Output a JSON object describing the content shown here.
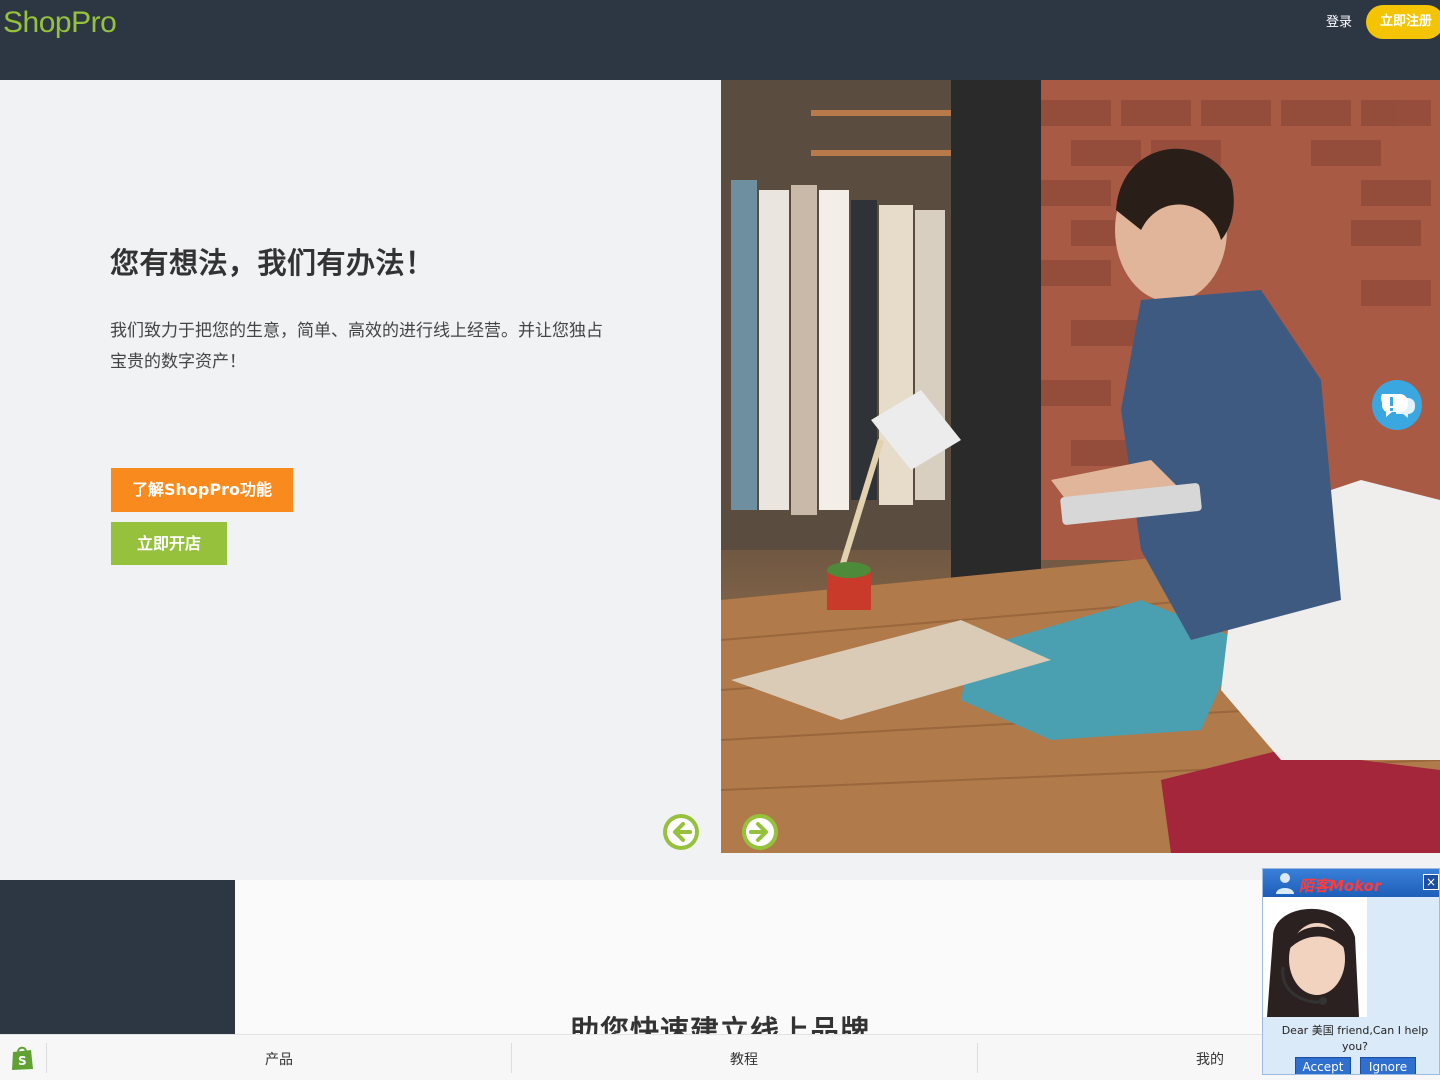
{
  "header": {
    "logo": "ShopPro",
    "login_label": "登录",
    "signup_label": "立即注册"
  },
  "hero": {
    "title": "您有想法，我们有办法！",
    "description": "我们致力于把您的生意，简单、高效的进行线上经营。并让您独占宝贵的数字资产！",
    "features_button": "了解ShopPro功能",
    "open_store_button": "立即开店"
  },
  "section": {
    "title": "助您快速建立线上品牌"
  },
  "bottom_nav": {
    "items": [
      {
        "label": "产品"
      },
      {
        "label": "教程"
      },
      {
        "label": "我的"
      }
    ]
  },
  "chat_widget": {
    "brand": "陌客Mokor",
    "message": "Dear 美国 friend,Can I help you?",
    "accept_label": "Accept",
    "ignore_label": "Ignore"
  },
  "icons": {
    "prev": "arrow-left-icon",
    "next": "arrow-right-icon",
    "feedback": "chat-bubble-icon",
    "shop": "shopping-bag-icon",
    "close": "close-icon"
  },
  "colors": {
    "header_bg": "#2d3643",
    "brand_green": "#95c13d",
    "accent_orange": "#f98a1d",
    "signup_yellow": "#f5c400",
    "chat_blue": "#3aa7e0"
  }
}
